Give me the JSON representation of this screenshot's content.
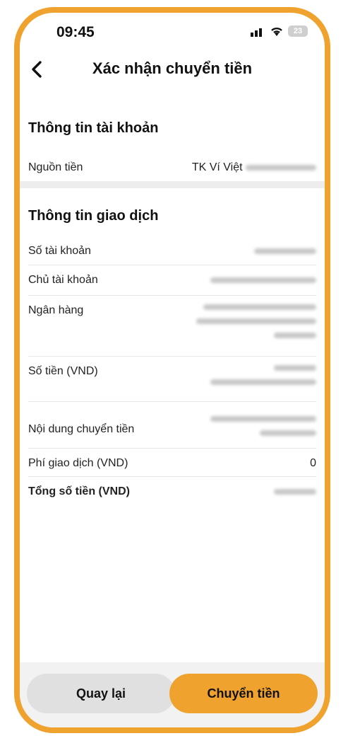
{
  "status": {
    "time": "09:45",
    "battery": "23"
  },
  "header": {
    "title": "Xác nhận chuyển tiền"
  },
  "account_info": {
    "heading": "Thông tin tài khoản",
    "source_label": "Nguồn tiền",
    "source_value": "TK Ví Việt"
  },
  "transaction_info": {
    "heading": "Thông tin giao dịch",
    "rows": [
      {
        "label": "Số tài khoản"
      },
      {
        "label": "Chủ tài khoản"
      },
      {
        "label": "Ngân hàng"
      },
      {
        "label": "Số tiền (VND)"
      },
      {
        "label": "Nội dung chuyển tiền"
      },
      {
        "label": "Phí giao dịch (VND)",
        "value": "0"
      },
      {
        "label": "Tổng số tiền (VND)"
      }
    ]
  },
  "buttons": {
    "back": "Quay lại",
    "confirm": "Chuyển tiền"
  },
  "colors": {
    "accent": "#f0a22e"
  }
}
